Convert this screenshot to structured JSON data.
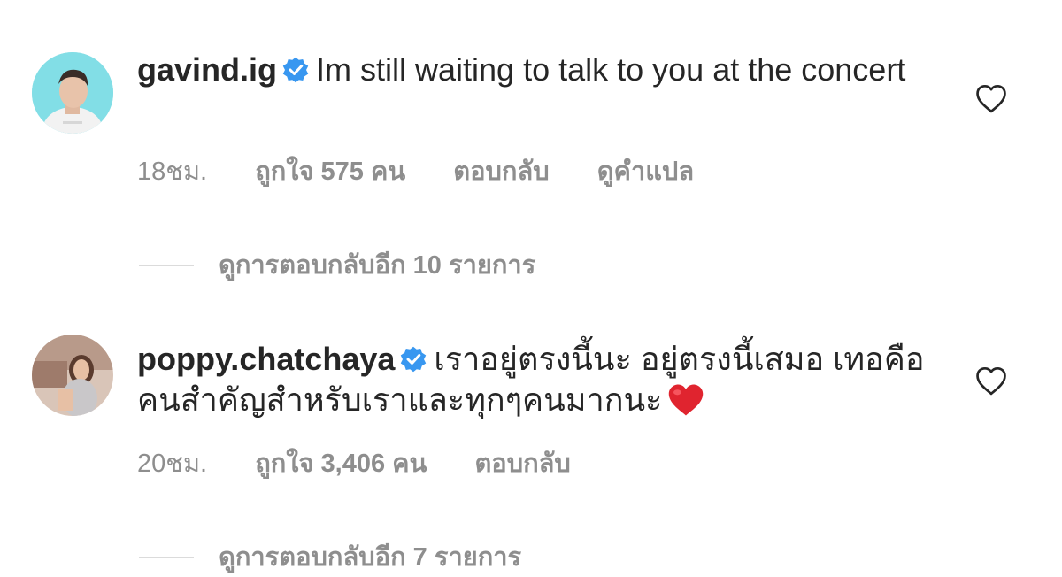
{
  "comments": [
    {
      "username": "gavind.ig",
      "text": "Im still waiting to talk to you at the concert",
      "time": "18ชม.",
      "likes": "ถูกใจ 575 คน",
      "reply": "ตอบกลับ",
      "translate": "ดูคำแปล",
      "view_replies": "ดูการตอบกลับอีก 10 รายการ",
      "verified": true
    },
    {
      "username": "poppy.chatchaya",
      "text": "เราอยู่ตรงนี้นะ อยู่ตรงนี้เสมอ เทอคือคนสำคัญสำหรับเราและทุกๆคนมากนะ",
      "emoji": "red-heart",
      "time": "20ชม.",
      "likes": "ถูกใจ 3,406 คน",
      "reply": "ตอบกลับ",
      "view_replies": "ดูการตอบกลับอีก 7 รายการ",
      "verified": true
    }
  ],
  "colors": {
    "text": "#262626",
    "muted": "#8e8e8e",
    "verified": "#3897f0",
    "divider": "#dbdbdb",
    "heart_emoji": "#e0242f"
  },
  "icons": [
    "verified-badge-icon",
    "heart-outline-icon",
    "red-heart-emoji"
  ]
}
